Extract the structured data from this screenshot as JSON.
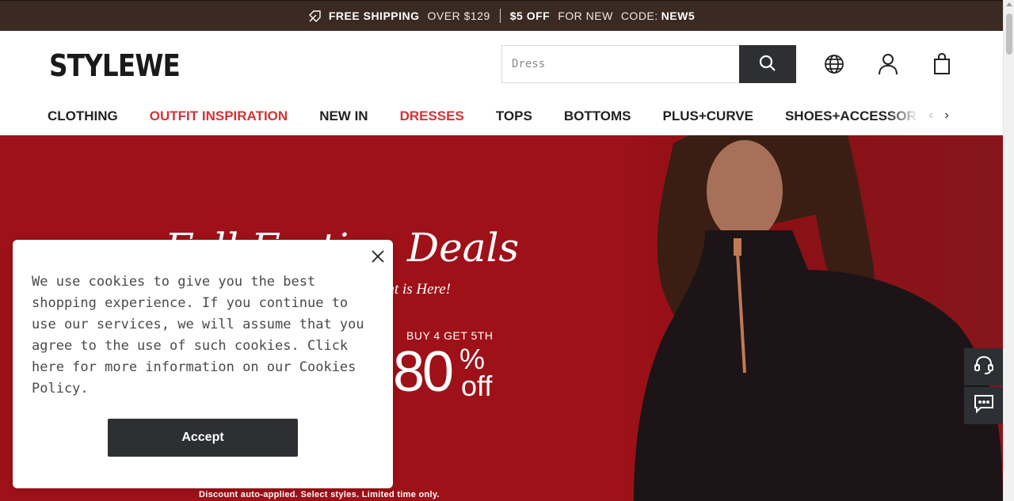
{
  "promo": {
    "shipping_bold": "FREE SHIPPING",
    "shipping_light": "OVER $129",
    "discount_bold": "$5 OFF",
    "discount_light": "FOR NEW",
    "code_label": "CODE:",
    "code_value": "NEW5"
  },
  "header": {
    "logo": "STYLEWE",
    "search_placeholder": "Dress",
    "icons": [
      "globe-icon",
      "user-icon",
      "shopping-bag-icon",
      "search-icon"
    ]
  },
  "nav": {
    "items": [
      {
        "label": "CLOTHING",
        "highlight": false
      },
      {
        "label": "OUTFIT INSPIRATION",
        "highlight": true
      },
      {
        "label": "NEW IN",
        "highlight": false
      },
      {
        "label": "DRESSES",
        "highlight": true
      },
      {
        "label": "TOPS",
        "highlight": false
      },
      {
        "label": "BOTTOMS",
        "highlight": false
      },
      {
        "label": "PLUS+CURVE",
        "highlight": false
      },
      {
        "label": "SHOES+ACCESSORIES",
        "highlight": false
      }
    ]
  },
  "hero": {
    "title": "Fall Festive Deals",
    "subtitle": "ent is Here!",
    "offer_top": "BUY 4 GET 5TH",
    "offer_value": "80",
    "offer_percent": "%",
    "offer_off": "off",
    "footnote": "Discount auto-applied. Select styles. Limited time only."
  },
  "cookie": {
    "message": "We use cookies to give you the best shopping experience. If you continue to use our services, we will assume that you agree to the use of such cookies. Click here for more information on our Cookies Policy.",
    "accept_label": "Accept"
  },
  "colors": {
    "promo_bg": "#3a2a22",
    "hero_bg": "#9e1118",
    "accent_red": "#d23434",
    "dark_button": "#2d2f33"
  }
}
